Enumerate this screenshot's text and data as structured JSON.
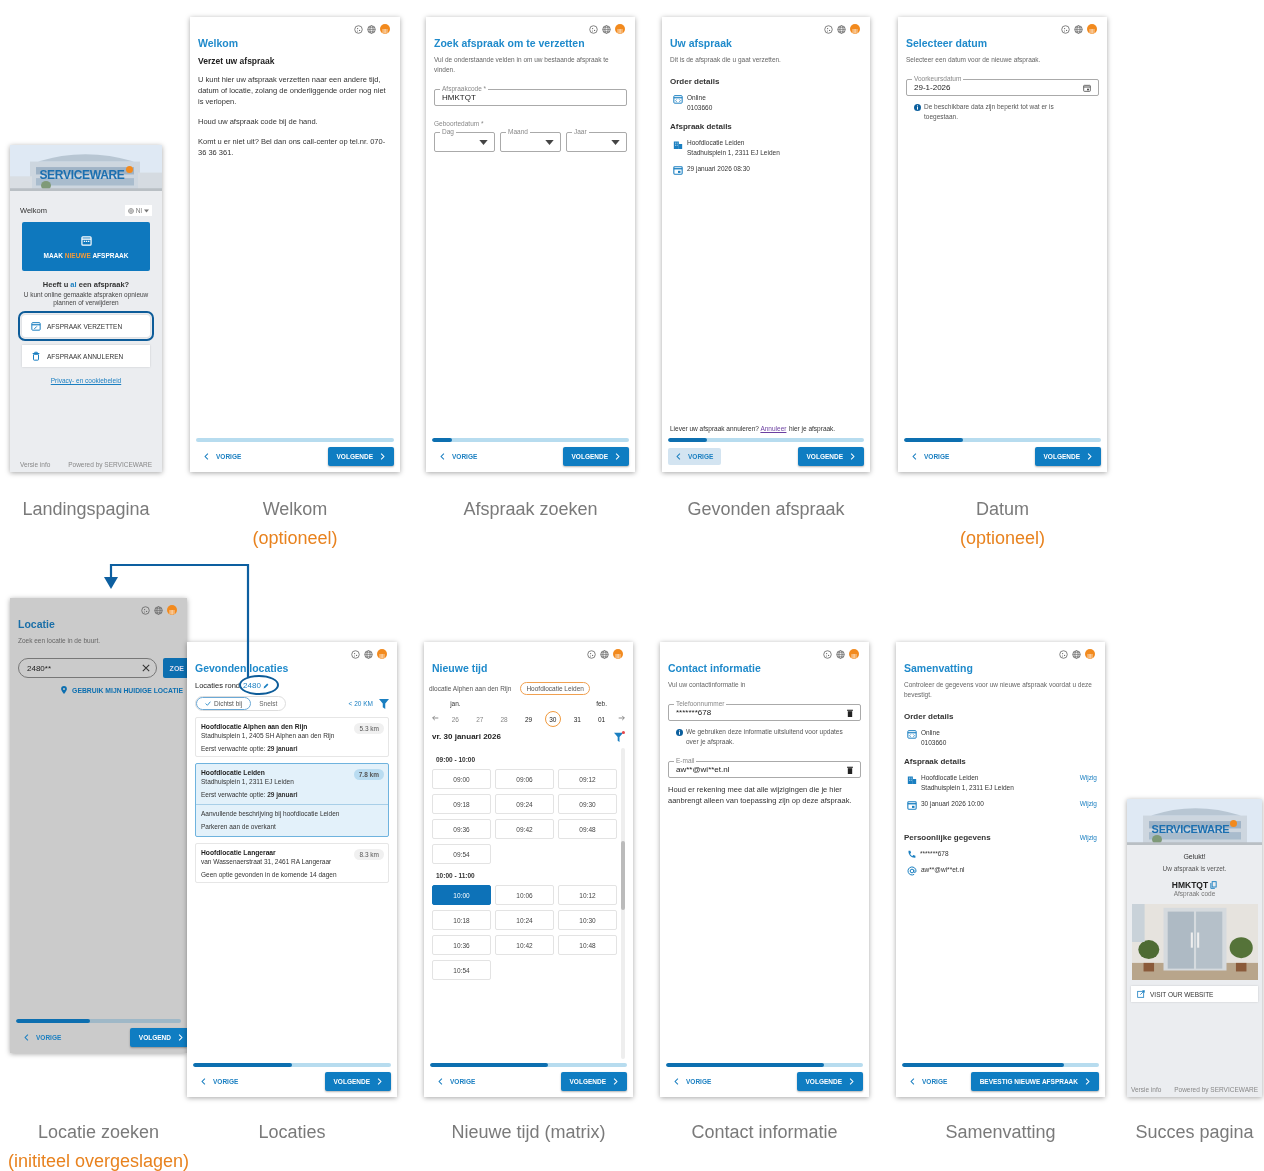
{
  "screens": [
    {
      "kind": "landing",
      "dimmed": false,
      "caption": "Landingspagina",
      "brand": "SERVICEWARE",
      "welcome": "Welkom",
      "language": "Nl",
      "new_button": {
        "before": "MAAK",
        "highlight": "NIEUWE",
        "after": "AFSPRAAK"
      },
      "question": {
        "before": "Heeft u",
        "highlight": "al",
        "after": "een afspraak?"
      },
      "hint": "U kunt online gemaakte afspraken opnieuw plannen of verwijderen",
      "actions": [
        {
          "kind": "reschedule",
          "label": "AFSPRAAK VERZETTEN",
          "highlighted": true
        },
        {
          "kind": "cancel",
          "label": "AFSPRAAK ANNULEREN",
          "highlighted": false
        }
      ],
      "privacy_link": "Privacy- en cookiebeleid",
      "version": "Versie info",
      "powered_by": "Powered by SERVICEWARE"
    },
    {
      "kind": "form",
      "dimmed": false,
      "caption": "Welkom",
      "note": "(optioneel)",
      "title": "Welkom",
      "back": "VORIGE",
      "back_focused": false,
      "next": "VOLGENDE",
      "blocks": [
        {
          "kind": "strong",
          "text": "Verzet uw afspraak"
        },
        {
          "kind": "text",
          "text": "U kunt hier uw afspraak verzetten naar een andere tijd, datum of locatie, zolang de onderliggende order nog niet is verlopen."
        },
        {
          "kind": "text",
          "text": "Houd uw afspraak code bij de hand."
        },
        {
          "kind": "text",
          "text": "Komt u er niet uit? Bel dan ons call-center op tel.nr. 070-36 36 361."
        }
      ]
    },
    {
      "kind": "form",
      "dimmed": false,
      "caption": "Afspraak zoeken",
      "title": "Zoek afspraak om te verzetten",
      "level": 0.1,
      "back": "VORIGE",
      "back_focused": false,
      "next": "VOLGENDE",
      "blocks": [
        {
          "kind": "subtitle",
          "text": "Vul de onderstaande velden in om uw bestaande afspraak te vinden."
        },
        {
          "kind": "input",
          "label": "Afspraakcode *",
          "value": "HMKTQT"
        },
        {
          "kind": "selects",
          "label": "Geboortedatum *",
          "options": [
            "Dag",
            "Maand",
            "Jaar"
          ]
        }
      ]
    },
    {
      "kind": "form",
      "dimmed": false,
      "caption": "Gevonden afspraak",
      "title": "Uw afspraak",
      "level": 0.2,
      "back": "VORIGE",
      "back_focused": true,
      "next": "VOLGENDE",
      "blocks": [
        {
          "kind": "subtitle",
          "text": "Dit is de afspraak die u gaat verzetten."
        },
        {
          "kind": "heading",
          "text": "Order details"
        },
        {
          "kind": "order_detail",
          "lines": [
            "Online",
            "0103660"
          ]
        },
        {
          "kind": "heading",
          "text": "Afspraak details"
        },
        {
          "kind": "address_detail",
          "lines": [
            "Hoofdlocatie Leiden",
            "Stadhuisplein 1, 2311 EJ Leiden"
          ]
        },
        {
          "kind": "date_detail",
          "lines": [
            "29 januari 2026 08:30"
          ]
        },
        {
          "kind": "footnote",
          "before": "Liever uw afspraak annuleren?",
          "link": "Annuleer ",
          "after": "hier je afspraak."
        }
      ]
    },
    {
      "kind": "form",
      "dimmed": false,
      "caption": "Datum",
      "note": "(optioneel)",
      "title": "Selecteer datum",
      "level": 0.3,
      "back": "VORIGE",
      "back_focused": false,
      "next": "VOLGENDE",
      "blocks": [
        {
          "kind": "subtitle",
          "text": "Selecteer een datum voor de nieuwe afspraak."
        },
        {
          "kind": "date_input",
          "label": "Voorkeursdatum",
          "value": "29-1-2026"
        },
        {
          "kind": "info",
          "text": "De beschikbare data zijn beperkt tot wat er is toegestaan."
        }
      ]
    },
    {
      "kind": "form",
      "dimmed": true,
      "caption": "Locatie zoeken",
      "note": "(inititeel overgeslagen)",
      "title": "Locatie",
      "level": 0.45,
      "back": "VORIGE",
      "back_focused": false,
      "next": "VOLGEND",
      "blocks": [
        {
          "kind": "subtitle",
          "text": "Zoek een locatie in de buurt."
        },
        {
          "kind": "search",
          "value": "2480**",
          "button": "ZOE"
        },
        {
          "kind": "location_link",
          "text": "GEBRUIK MIJN HUIDIGE LOCATIE"
        }
      ]
    },
    {
      "kind": "form",
      "dimmed": false,
      "caption": "Locaties",
      "title": "Gevonden locaties",
      "level": 0.5,
      "back": "VORIGE",
      "back_focused": false,
      "next": "VOLGENDE",
      "blocks": [
        {
          "kind": "around",
          "label": "Locaties rond",
          "value": "2480",
          "annotated": true
        },
        {
          "kind": "sort",
          "options": [
            {
              "label": "Dichtst bij",
              "selected": true
            },
            {
              "label": "Snelst",
              "selected": false
            }
          ],
          "radius": "< 20 KM",
          "filter_active": false
        },
        {
          "kind": "location_card",
          "name": "Hoofdlocatie Alphen aan den Rijn",
          "distance": "5.3 km",
          "address": "Stadhuisplein 1, 2405 SH Alphen aan den Rijn",
          "option": "Eerst verwachte optie: **29 januari**",
          "selected": false
        },
        {
          "kind": "location_card",
          "name": "Hoofdlocatie Leiden",
          "distance": "7.8 km",
          "address": "Stadhuisplein 1, 2311 EJ Leiden",
          "option": "Eerst verwachte optie: **29 januari**",
          "selected": true,
          "notes": [
            "Aanvullende beschrijving bij hoofdlocatie Leiden",
            "Parkeren aan de overkant"
          ]
        },
        {
          "kind": "location_card",
          "name": "Hoofdlocatie Langeraar",
          "distance": "8.3 km",
          "address": "van Wassenaerstraat 31, 2461 RA Langeraar",
          "option": "Geen optie gevonden in de komende 14 dagen",
          "selected": false
        }
      ]
    },
    {
      "kind": "form",
      "dimmed": false,
      "caption": "Nieuwe tijd (matrix)",
      "title": "Nieuwe tijd",
      "level": 0.6,
      "back": "VORIGE",
      "back_focused": false,
      "next": "VOLGENDE",
      "blocks": [
        {
          "kind": "chips",
          "items": [
            {
              "label": "dlocatie Alphen aan den Rijn",
              "selected": false
            },
            {
              "label": "Hoofdlocatie Leiden",
              "selected": true
            }
          ]
        },
        {
          "kind": "days",
          "items": [
            {
              "label": "26",
              "month": "jan.",
              "disabled": true,
              "selected": false
            },
            {
              "label": "27",
              "disabled": true,
              "selected": false
            },
            {
              "label": "28",
              "disabled": true,
              "selected": false
            },
            {
              "label": "29",
              "disabled": false,
              "selected": false
            },
            {
              "label": "30",
              "disabled": false,
              "selected": true
            },
            {
              "label": "31",
              "disabled": false,
              "selected": false
            },
            {
              "label": "01",
              "month": "feb.",
              "disabled": false,
              "selected": false
            }
          ]
        },
        {
          "kind": "date_heading",
          "text": "vr. 30 januari 2026",
          "filter_active": true
        },
        {
          "kind": "slots",
          "groups": [
            {
              "label": "09:00 - 10:00",
              "slots": [
                {
                  "label": "09:00",
                  "selected": false
                },
                {
                  "label": "09:06",
                  "selected": false
                },
                {
                  "label": "09:12",
                  "selected": false
                },
                {
                  "label": "09:18",
                  "selected": false
                },
                {
                  "label": "09:24",
                  "selected": false
                },
                {
                  "label": "09:30",
                  "selected": false
                },
                {
                  "label": "09:36",
                  "selected": false
                },
                {
                  "label": "09:42",
                  "selected": false
                },
                {
                  "label": "09:48",
                  "selected": false
                },
                {
                  "label": "09:54",
                  "selected": false
                }
              ]
            },
            {
              "label": "10:00 - 11:00",
              "slots": [
                {
                  "label": "10:00",
                  "selected": true
                },
                {
                  "label": "10:06",
                  "selected": false
                },
                {
                  "label": "10:12",
                  "selected": false
                },
                {
                  "label": "10:18",
                  "selected": false
                },
                {
                  "label": "10:24",
                  "selected": false
                },
                {
                  "label": "10:30",
                  "selected": false
                },
                {
                  "label": "10:36",
                  "selected": false
                },
                {
                  "label": "10:42",
                  "selected": false
                },
                {
                  "label": "10:48",
                  "selected": false
                },
                {
                  "label": "10:54",
                  "selected": false
                }
              ]
            }
          ]
        }
      ]
    },
    {
      "kind": "form",
      "dimmed": false,
      "caption": "Contact informatie",
      "title": "Contact informatie",
      "level": 0.8,
      "back": "VORIGE",
      "back_focused": false,
      "next": "VOLGENDE",
      "blocks": [
        {
          "kind": "subtitle",
          "text": "Vul uw contactinformatie in"
        },
        {
          "kind": "masked_input",
          "label": "Telefoonnummer",
          "value": "*******678"
        },
        {
          "kind": "info",
          "text": "We gebruiken deze informatie uitsluitend voor updates over je afspraak."
        },
        {
          "kind": "masked_input",
          "label": "E-mail",
          "value": "aw**@wi**et.nl"
        },
        {
          "kind": "text",
          "text": "Houd er rekening mee dat alle wijzigingen die je hier aanbrengt alleen van toepassing zijn op deze afspraak."
        }
      ]
    },
    {
      "kind": "form",
      "dimmed": false,
      "caption": "Samenvatting",
      "title": "Samenvatting",
      "level": 0.82,
      "back": "VORIGE",
      "back_focused": false,
      "next": "BEVESTIG NIEUWE AFSPRAAK",
      "blocks": [
        {
          "kind": "subtitle",
          "text": "Controleer de gegevens voor uw nieuwe afspraak voordat u deze bevestigt."
        },
        {
          "kind": "heading",
          "text": "Order details"
        },
        {
          "kind": "order_detail",
          "lines": [
            "Online",
            "0103660"
          ]
        },
        {
          "kind": "heading",
          "text": "Afspraak details"
        },
        {
          "kind": "address_detail",
          "lines": [
            "Hoofdlocatie Leiden",
            "Stadhuisplein 1, 2311 EJ Leiden"
          ],
          "edit": "Wijzig"
        },
        {
          "kind": "date_detail",
          "lines": [
            "30 januari 2026 10:00"
          ],
          "edit": "Wijzig"
        },
        {
          "kind": "heading",
          "text": "Persoonlijke gegevens",
          "edit": "Wijzig"
        },
        {
          "kind": "phone_detail",
          "lines": [
            "*******678"
          ]
        },
        {
          "kind": "email_detail",
          "lines": [
            "aw**@wi**et.nl"
          ]
        }
      ]
    },
    {
      "kind": "success",
      "dimmed": false,
      "caption": "Succes pagina",
      "brand": "SERVICEWARE",
      "heading": "Gelukt!",
      "message": "Uw afspraak is verzet.",
      "code": "HMKTQT",
      "code_label": "Afspraak code",
      "website_button": "VISIT OUR WEBSITE",
      "version": "Versie info",
      "powered_by": "Powered by SERVICEWARE"
    }
  ]
}
